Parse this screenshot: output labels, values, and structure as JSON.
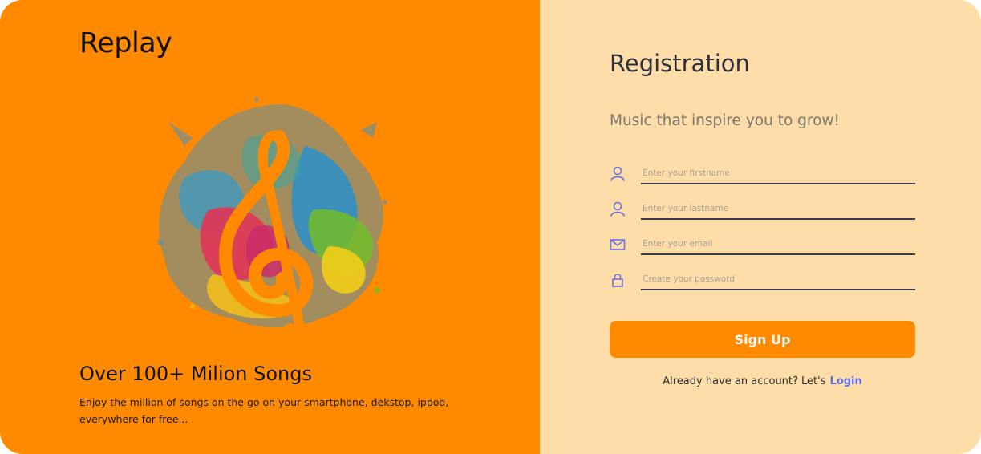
{
  "brand": {
    "name": "Replay"
  },
  "promo": {
    "title": "Over 100+ Milion Songs",
    "text": "Enjoy the million of songs on the go on your smartphone, dekstop, ippod, everywhere for free..."
  },
  "registration": {
    "title": "Registration",
    "subtitle": "Music that inspire you to grow!",
    "fields": [
      {
        "icon": "user-icon",
        "placeholder": "Enter your firstname",
        "value": ""
      },
      {
        "icon": "user-icon",
        "placeholder": "Enter your lastname",
        "value": ""
      },
      {
        "icon": "mail-icon",
        "placeholder": "Enter your email",
        "value": ""
      },
      {
        "icon": "lock-icon",
        "placeholder": "Create your password",
        "value": ""
      }
    ],
    "submit_label": "Sign Up",
    "login_prompt": "Already have an account? Let's",
    "login_label": "Login"
  },
  "colors": {
    "left_panel": "#ff8a00",
    "right_panel": "#fedda9",
    "accent": "#ff8a00",
    "icon": "#6b72e6",
    "link": "#5b6bf0"
  }
}
